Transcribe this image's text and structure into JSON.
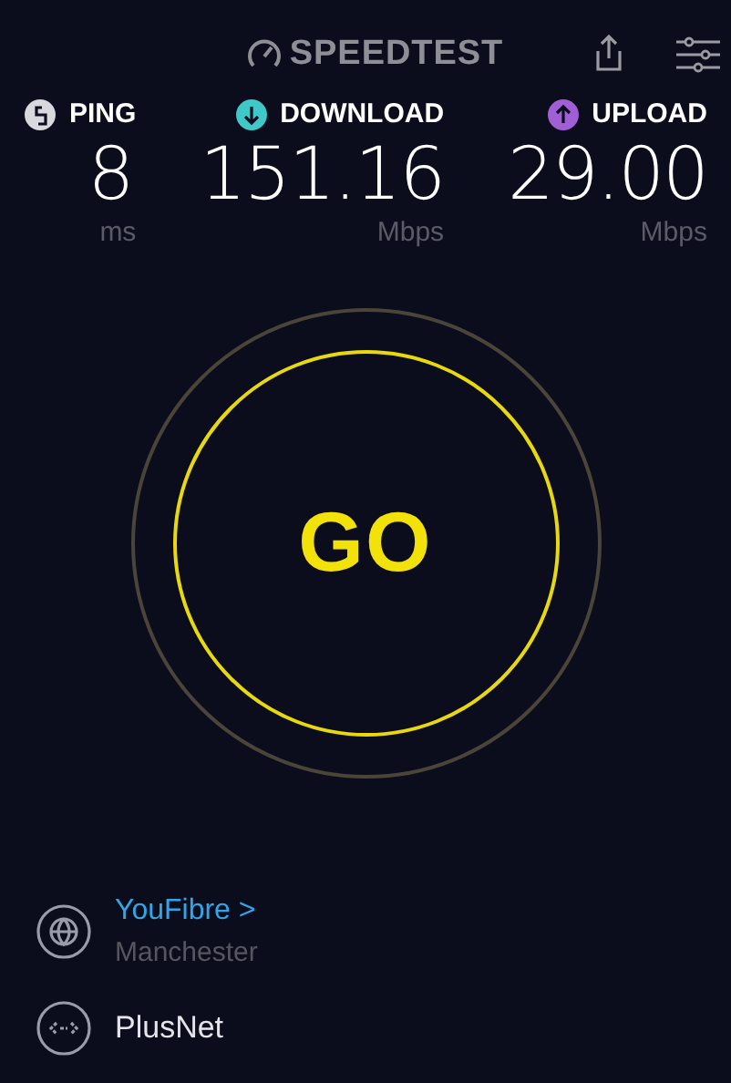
{
  "header": {
    "title": "SPEEDTEST"
  },
  "metrics": [
    {
      "kind": "ping",
      "label": "PING",
      "value": "8",
      "unit": "ms",
      "color": "#d8d8de"
    },
    {
      "kind": "download",
      "label": "DOWNLOAD",
      "value": "151.16",
      "unit": "Mbps",
      "color": "#3fc8c8"
    },
    {
      "kind": "upload",
      "label": "UPLOAD",
      "value": "29.00",
      "unit": "Mbps",
      "color": "#a15fd6"
    }
  ],
  "go_button": {
    "label": "GO"
  },
  "provider": {
    "name": "YouFibre",
    "chevron": ">",
    "location": "Manchester"
  },
  "server": {
    "name": "PlusNet"
  }
}
